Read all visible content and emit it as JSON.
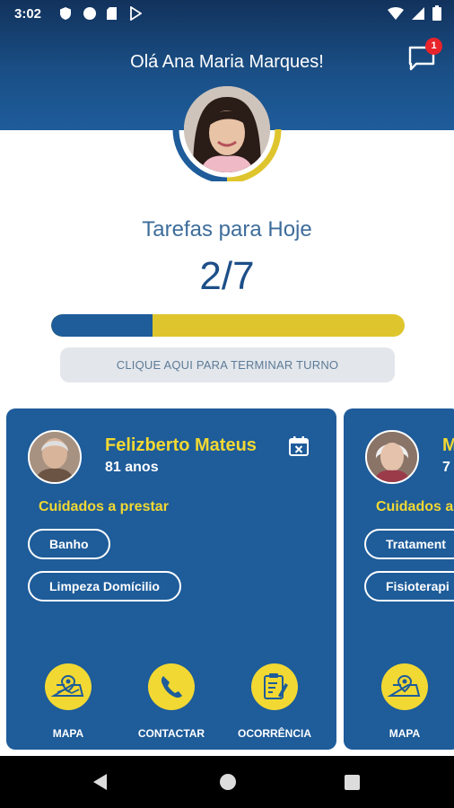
{
  "status": {
    "time": "3:02"
  },
  "header": {
    "greeting": "Olá Ana Maria Marques!",
    "notification_count": "1"
  },
  "tasks": {
    "title": "Tarefas para Hoje",
    "count": "2/7",
    "progress_fraction": 0.2857,
    "end_shift_label": "CLIQUE AQUI PARA TERMINAR TURNO"
  },
  "cards": [
    {
      "patient_name": "Felizberto Mateus",
      "patient_age": "81 anos",
      "care_title": "Cuidados a prestar",
      "services": [
        "Banho",
        "Limpeza Domícilio"
      ],
      "actions": [
        "MAPA",
        "CONTACTAR",
        "OCORRÊNCIA"
      ]
    },
    {
      "patient_name": "M",
      "patient_age": "7",
      "care_title": "Cuidados a",
      "services": [
        "Tratament",
        "Fisioterapi"
      ],
      "actions": [
        "MAPA"
      ]
    }
  ],
  "colors": {
    "primary": "#1e5c9a",
    "accent": "#f2d832",
    "header_dark": "#12325c",
    "badge": "#e8232a"
  },
  "icons": [
    "shield-icon",
    "cloud-icon",
    "sd-card-icon",
    "play-store-icon",
    "wifi-icon",
    "signal-icon",
    "battery-icon",
    "chat-icon",
    "calendar-remove-icon",
    "map-icon",
    "phone-icon",
    "clipboard-icon"
  ]
}
